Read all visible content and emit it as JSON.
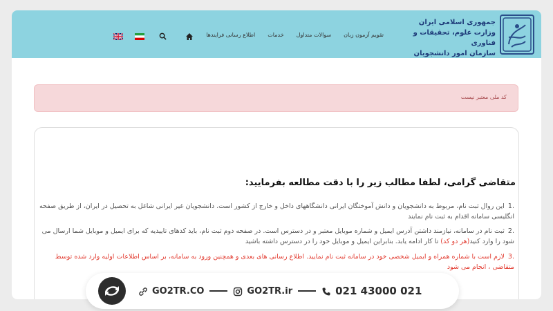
{
  "header": {
    "org_line1": "جمهوری اسلامی ایران",
    "org_line2": "وزارت علوم، تحقیقات و فناوری",
    "org_line3": "سازمان امور دانشجویان",
    "nav": [
      {
        "label": "اطلاع رسانی فرایندها",
        "name": "nav-process-info"
      },
      {
        "label": "خدمات",
        "name": "nav-services"
      },
      {
        "label": "سوالات متداول",
        "name": "nav-faq"
      },
      {
        "label": "تقویم آزمون زبان",
        "name": "nav-language-exam-calendar"
      }
    ],
    "icons": [
      "home-icon",
      "search-icon",
      "iran-flag-icon",
      "uk-flag-icon"
    ]
  },
  "alert": {
    "text": "کد ملی معتبر نیست"
  },
  "content": {
    "title": "متقاضی گرامی، لطفا مطالب زیر را با دقت مطالعه بفرمایید:",
    "item1_num": ".1",
    "item1_text": "این روال ثبت نام، مربوط به دانشجویان و دانش آموختگان ایرانی دانشگاههای داخل و خارج از کشور است. دانشجویان غیر ایرانی شاغل به تحصیل در ایران، از طریق صفحه انگلیسی سامانه اقدام به ثبت نام نمایند",
    "item2_num": ".2",
    "item2_text_a": "ثبت نام در سامانه، نیازمند داشتن آدرس ایمیل و شماره موبایل معتبر و در دسترس است. در صفحه دوم ثبت نام، باید کدهای تاییدیه که برای ایمیل و موبایل شما ارسال می شود را وارد کنید",
    "item2_highlight": "(هر دو کد)",
    "item2_text_b": " تا کار ادامه یابد. بنابراین ایمیل و موبایل خود را در دسترس داشته باشید",
    "item3_num": ".3",
    "item3_text": "لازم است با شماره همراه و ایمیل شخصی خود در سامانه ثبت نام نمایید. اطلاع رسانی های بعدی و همچنین ورود به سامانه، بر اساس اطلاعات اولیه وارد شده توسط متقاضی ، انجام می شود"
  },
  "footer": {
    "site": "GO2TR.CO",
    "instagram": "GO2TR.ir",
    "phone": "021 43000 021"
  },
  "colors": {
    "navbar": "#8dd3e0",
    "alert_bg": "#f6d8da",
    "alert_text": "#a84b4f",
    "highlight": "#e23b30",
    "brand_dark": "#2d2d2d"
  }
}
